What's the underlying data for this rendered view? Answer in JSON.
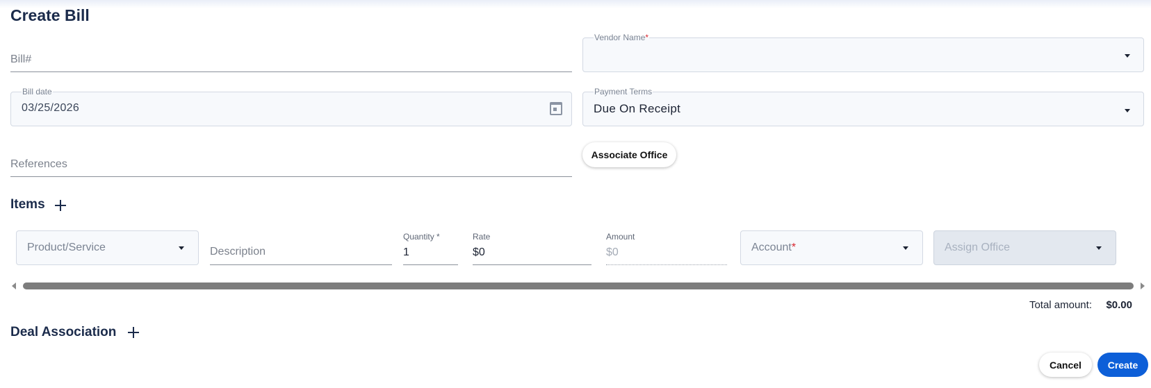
{
  "page": {
    "title": "Create Bill"
  },
  "form": {
    "bill_number": {
      "placeholder": "Bill#"
    },
    "vendor_name": {
      "label": "Vendor Name",
      "required_mark": "*",
      "value": ""
    },
    "bill_date": {
      "label": "Bill date",
      "value": "03/25/2026"
    },
    "payment_terms": {
      "label": "Payment Terms",
      "value": "Due On Receipt"
    },
    "references": {
      "placeholder": "References"
    },
    "associate_office_label": "Associate Office"
  },
  "items": {
    "title": "Items",
    "product_service": {
      "placeholder": "Product/Service"
    },
    "description": {
      "placeholder": "Description"
    },
    "quantity": {
      "label": "Quantity",
      "required_mark": "*",
      "value": "1"
    },
    "rate": {
      "label": "Rate",
      "value": "$0"
    },
    "amount": {
      "label": "Amount",
      "value": "$0"
    },
    "account": {
      "placeholder": "Account",
      "required_mark": "*"
    },
    "assign_office": {
      "placeholder": "Assign Office"
    }
  },
  "totals": {
    "label": "Total amount:",
    "value": "$0.00"
  },
  "deal_association": {
    "title": "Deal Association"
  },
  "actions": {
    "cancel_label": "Cancel",
    "create_label": "Create"
  },
  "icons": [
    "calendar-icon",
    "chevron-down-icon",
    "plus-icon",
    "scroll-left-arrow-icon",
    "scroll-right-arrow-icon"
  ],
  "colors": {
    "primary": "#0d5fd8",
    "required": "#d8262f",
    "heading": "#1b2b4b"
  }
}
